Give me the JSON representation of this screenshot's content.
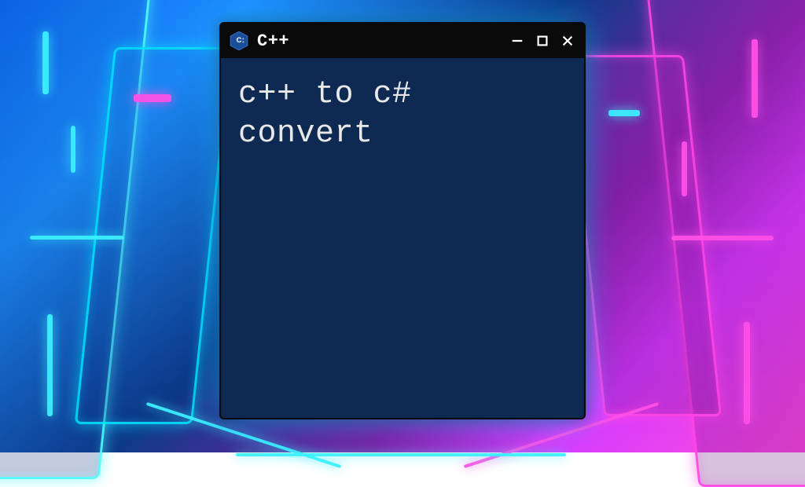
{
  "window": {
    "title": "C++",
    "icon_name": "cpp-logo-icon"
  },
  "terminal": {
    "content": "c++ to c#\nconvert"
  },
  "colors": {
    "window_bg": "#0f2a52",
    "titlebar_bg": "#0a0a0a",
    "text": "#e8e8e8"
  }
}
